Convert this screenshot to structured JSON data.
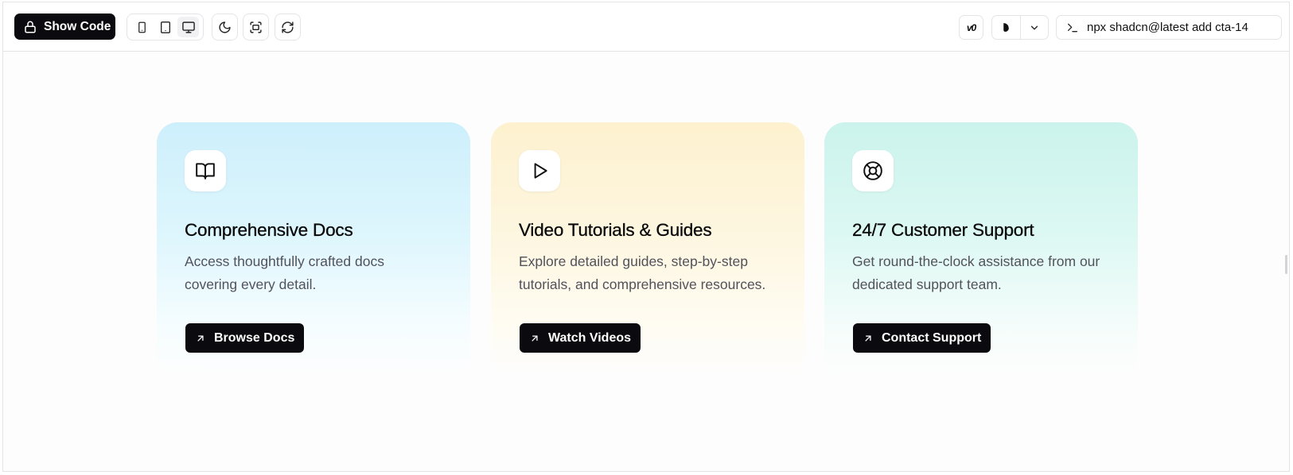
{
  "toolbar": {
    "show_code_label": "Show Code",
    "command": "npx shadcn@latest add cta-14",
    "v0_label": "v0"
  },
  "cards": [
    {
      "title": "Comprehensive Docs",
      "description": "Access thoughtfully crafted docs covering every detail.",
      "cta": "Browse Docs",
      "icon": "book-open-icon",
      "accent": "#cdeffc"
    },
    {
      "title": "Video Tutorials & Guides",
      "description": "Explore detailed guides, step-by-step tutorials, and comprehensive resources.",
      "cta": "Watch Videos",
      "icon": "play-icon",
      "accent": "#fdf1cf"
    },
    {
      "title": "24/7 Customer Support",
      "description": "Get round-the-clock assistance from our dedicated support team.",
      "cta": "Contact Support",
      "icon": "life-buoy-icon",
      "accent": "#cbf3ec"
    }
  ],
  "colors": {
    "button_bg": "#0b0b0f",
    "border": "#e4e4e7",
    "muted_text": "#52525b"
  }
}
